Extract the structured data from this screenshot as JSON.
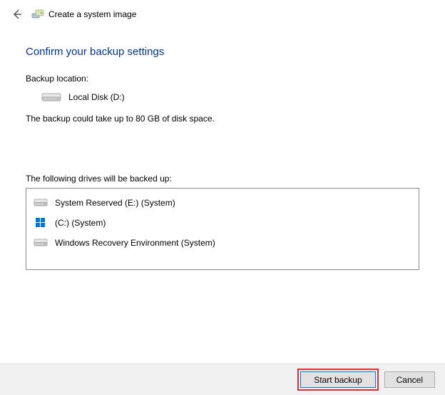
{
  "header": {
    "title": "Create a system image"
  },
  "main": {
    "heading": "Confirm your backup settings",
    "backup_location_label": "Backup location:",
    "backup_location_value": "Local Disk (D:)",
    "space_note": "The backup could take up to 80 GB of disk space.",
    "drives_label": "The following drives will be backed up:",
    "drives": [
      {
        "icon": "hdd",
        "label": "System Reserved (E:) (System)"
      },
      {
        "icon": "win",
        "label": "(C:) (System)"
      },
      {
        "icon": "hdd",
        "label": "Windows Recovery Environment (System)"
      }
    ]
  },
  "footer": {
    "start_label": "Start backup",
    "cancel_label": "Cancel"
  }
}
